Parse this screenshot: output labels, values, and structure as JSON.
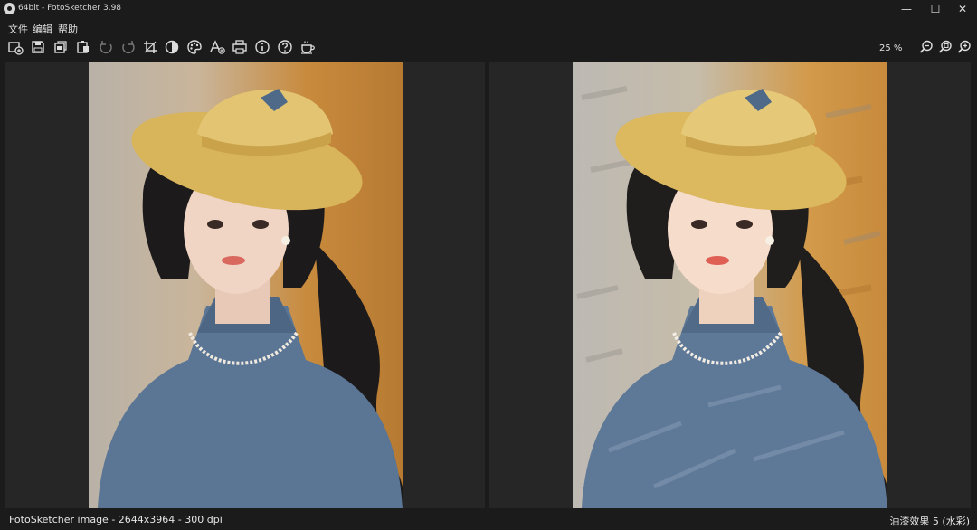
{
  "window": {
    "title": "64bit - FotoSketcher 3.98",
    "minimize_glyph": "—",
    "maximize_glyph": "☐",
    "close_glyph": "✕"
  },
  "menu": {
    "items": [
      {
        "label": "文件"
      },
      {
        "label": "编辑"
      },
      {
        "label": "帮助"
      }
    ]
  },
  "toolbar": {
    "icons": [
      "open-image-icon",
      "save-icon",
      "copy-icon",
      "paste-icon",
      "rotate-left-icon",
      "rotate-right-icon",
      "crop-icon",
      "contrast-icon",
      "palette-icon",
      "add-text-icon",
      "print-icon",
      "info-icon",
      "help-icon",
      "coffee-icon"
    ],
    "zoom_level": "25 %",
    "zoom_icons": [
      "zoom-out-icon",
      "zoom-fit-icon",
      "zoom-in-icon"
    ]
  },
  "colors": {
    "background": "#1b1b1b",
    "pane": "#262626",
    "hat": "#d8b45a",
    "dress": "#5b7594",
    "hair": "#1c1a1a",
    "skin": "#f0d4c4",
    "backdrop_warm": "#c88a3c",
    "backdrop_gray": "#b9b2a8"
  },
  "status": {
    "left": "FotoSketcher image - 2644x3964 - 300 dpi",
    "right": "油漆效果 5 (水彩)"
  }
}
